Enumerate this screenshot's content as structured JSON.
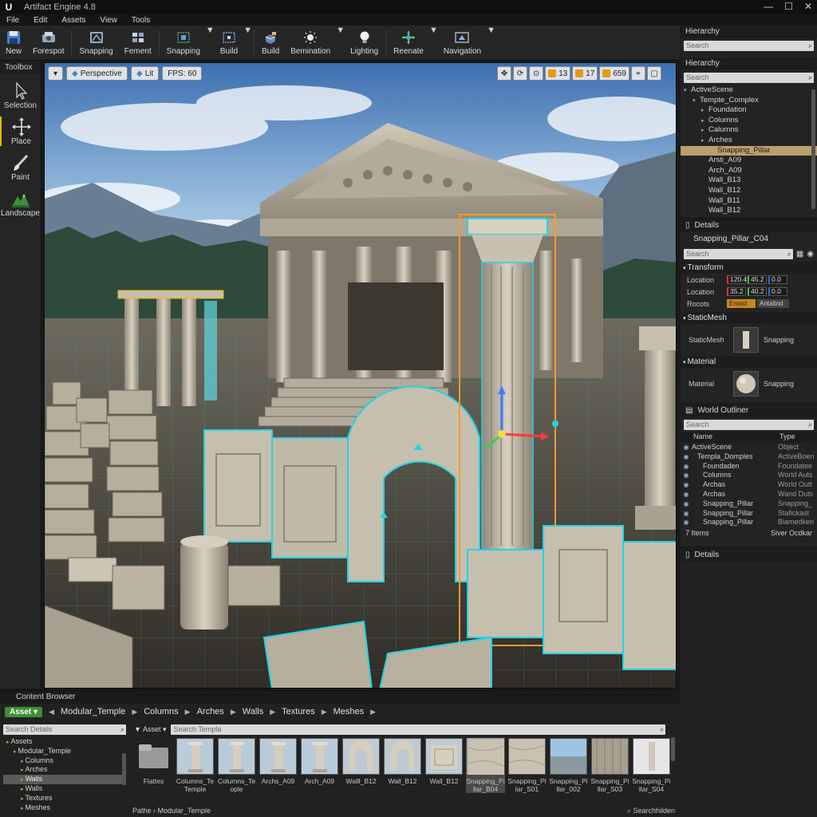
{
  "titlebar": {
    "title": "Artifact Engine 4.8"
  },
  "menu": [
    "File",
    "Edit",
    "Assets",
    "View",
    "Tools"
  ],
  "toolbar": [
    {
      "label": "New",
      "icon": "floppy-icon"
    },
    {
      "label": "Forespot",
      "icon": "forespot-icon"
    },
    {
      "label": "Snapping",
      "icon": "snapping-icon"
    },
    {
      "label": "Fement",
      "icon": "fement-icon"
    },
    {
      "label": "Snapping",
      "icon": "snapping-grid-icon"
    },
    {
      "label": "Build",
      "icon": "build-icon"
    },
    {
      "label": "Build",
      "icon": "build-blocks-icon"
    },
    {
      "label": "Bemination",
      "icon": "sun-icon"
    },
    {
      "label": "Lighting",
      "icon": "lightbulb-icon"
    },
    {
      "label": "Reenate",
      "icon": "transform-icon"
    },
    {
      "label": "Navigation",
      "icon": "navigation-icon"
    }
  ],
  "toolbox": {
    "title": "Toolbox",
    "tools": [
      {
        "label": "Selection",
        "icon": "cursor-icon"
      },
      {
        "label": "Place",
        "icon": "move-icon"
      },
      {
        "label": "Paint",
        "icon": "brush-icon"
      },
      {
        "label": "Landscape",
        "icon": "landscape-icon"
      }
    ]
  },
  "viewport": {
    "perspective": "Perspective",
    "lit": "Lit",
    "fps": "FPS: 60",
    "snap_values": [
      "13",
      "17",
      "659"
    ]
  },
  "hierarchy_top": {
    "title": "Hierarchy",
    "search": "Search"
  },
  "hierarchy": {
    "title": "Hierarchy",
    "search": "Search",
    "items": [
      {
        "label": "ActiveScene",
        "depth": 0,
        "arrow": "▾"
      },
      {
        "label": "Tempte_Complex",
        "depth": 1,
        "arrow": "▾"
      },
      {
        "label": "Foundation",
        "depth": 2,
        "arrow": "▸"
      },
      {
        "label": "Columns",
        "depth": 2,
        "arrow": "▸"
      },
      {
        "label": "Calumns",
        "depth": 2,
        "arrow": "▸"
      },
      {
        "label": "Arches",
        "depth": 2,
        "arrow": "▸"
      },
      {
        "label": "Snapping_Pillar",
        "depth": 3,
        "arrow": "",
        "selected": true
      },
      {
        "label": "Arsti_A09",
        "depth": 2,
        "arrow": ""
      },
      {
        "label": "Arch_A09",
        "depth": 2,
        "arrow": ""
      },
      {
        "label": "Wall_B13",
        "depth": 2,
        "arrow": ""
      },
      {
        "label": "Wall_B12",
        "depth": 2,
        "arrow": ""
      },
      {
        "label": "Wall_B11",
        "depth": 2,
        "arrow": ""
      },
      {
        "label": "Wall_B12",
        "depth": 2,
        "arrow": ""
      }
    ]
  },
  "details": {
    "title": "Details",
    "object": "Snapping_Pillar_C04",
    "search": "Search",
    "transform": "Transform",
    "rows": [
      {
        "label": "Location",
        "values": [
          "120.4",
          "45.2",
          "0.0"
        ]
      },
      {
        "label": "Location",
        "values": [
          "35.2",
          "40.2",
          "0.0"
        ]
      }
    ],
    "rotation": {
      "label": "Rocots",
      "values": [
        "Enlaid",
        "Antaltnd"
      ]
    },
    "static_mesh": {
      "section": "StaticMesh",
      "label": "StaticMesh",
      "asset": "Snapping"
    },
    "material": {
      "section": "Material",
      "label": "Material",
      "asset": "Snapping"
    }
  },
  "world_outliner": {
    "title": "World Outliner",
    "search": "Search",
    "col_name": "Name",
    "col_type": "Type",
    "rows": [
      {
        "name": "ActiveScene",
        "type": "Object",
        "depth": 0
      },
      {
        "name": "Templa_Domples",
        "type": "ActiveBoen",
        "depth": 1
      },
      {
        "name": "Foundaden",
        "type": "Foundatee",
        "depth": 2
      },
      {
        "name": "Columns",
        "type": "World Auts",
        "depth": 2
      },
      {
        "name": "Archas",
        "type": "World Outt",
        "depth": 2
      },
      {
        "name": "Archas",
        "type": "Wand Duts",
        "depth": 2
      },
      {
        "name": "Snapping_Pillar",
        "type": "Snapping_",
        "depth": 2
      },
      {
        "name": "Snapping_Pillar",
        "type": "Stafickast",
        "depth": 2
      },
      {
        "name": "Snapping_Pillar",
        "type": "Biamedken",
        "depth": 2
      }
    ],
    "count": "7 Items",
    "footer_button": "Siver Ocdkar"
  },
  "details_bottom": {
    "title": "Details"
  },
  "content_browser": {
    "title": "Content Browser",
    "asset_button": "Asset",
    "breadcrumb": [
      "Modular_Temple",
      "Columns",
      "Arches",
      "Walls",
      "Textures",
      "Meshes"
    ],
    "tree_search": "Search Details",
    "tree": [
      {
        "label": "Assets",
        "depth": 0
      },
      {
        "label": "Modular_Temple",
        "depth": 1
      },
      {
        "label": "Columns",
        "depth": 2
      },
      {
        "label": "Arches",
        "depth": 2
      },
      {
        "label": "Walls",
        "depth": 2,
        "selected": true
      },
      {
        "label": "Walls",
        "depth": 2
      },
      {
        "label": "Textures",
        "depth": 2
      },
      {
        "label": "Meshes",
        "depth": 2
      }
    ],
    "filter": "Asset",
    "search": "Search Templa",
    "items": [
      {
        "label": "Flattes",
        "kind": "folder"
      },
      {
        "label": "Columns_Te\nTemple",
        "kind": "column"
      },
      {
        "label": "Columns_Te\nople",
        "kind": "column"
      },
      {
        "label": "Archs_A09",
        "kind": "column"
      },
      {
        "label": "Arch_A09",
        "kind": "column"
      },
      {
        "label": "Walll_B12",
        "kind": "arch"
      },
      {
        "label": "Wall_B12",
        "kind": "arch"
      },
      {
        "label": "Wall_B12",
        "kind": "wall"
      },
      {
        "label": "Snapping_Pi\nllar_B04",
        "kind": "tex",
        "selected": true
      },
      {
        "label": "Snapping_Pl\nlar_S01",
        "kind": "tex"
      },
      {
        "label": "Snapping_Pi\nllar_002",
        "kind": "sky"
      },
      {
        "label": "Snapping_Pi\nllar_S03",
        "kind": "tex2"
      },
      {
        "label": "Snapping_Pi\nllar_S04",
        "kind": "pillar"
      }
    ],
    "path_label": "Pathe",
    "path_value": "Modular_Temple",
    "status_right": "Searchhilden"
  },
  "colors": {
    "accent_yellow": "#e6b800",
    "selection_cyan": "#22d3e6",
    "selection_orange": "#ff9a2e",
    "asset_green": "#3c8f35"
  }
}
